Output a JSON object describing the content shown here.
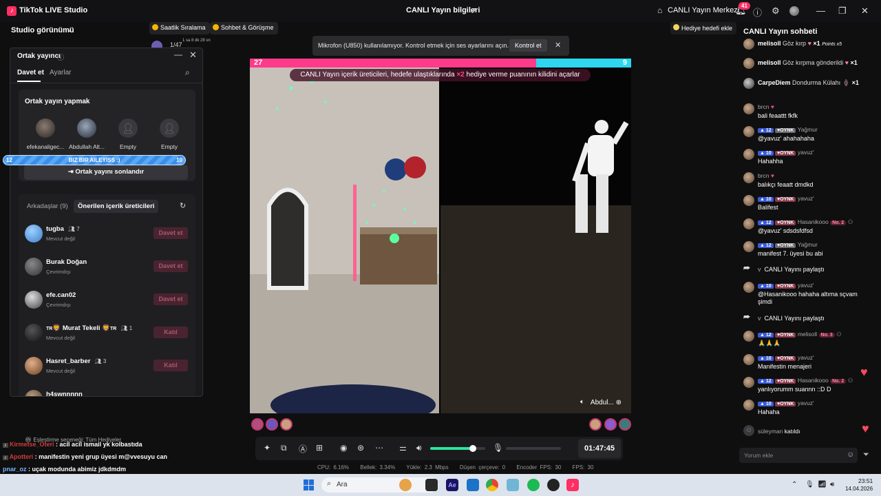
{
  "titlebar": {
    "app_name": "TikTok LIVE Studio",
    "live_info": "CANLI Yayın bilgileri",
    "live_center": "CANLI Yayın Merkezi",
    "notification_count": "41"
  },
  "studio": {
    "view_label": "Studio görünümü",
    "chips": [
      "Saatlik Sıralama",
      "Sohbet & Görüşme"
    ],
    "viewer_counter": "1/47",
    "viewer_time": "1 sa 8 dk 28 sn"
  },
  "cohost": {
    "title": "Ortak yayıncı",
    "tabs": [
      "Davet et",
      "Ayarlar"
    ],
    "cohosting_title": "Ortak yayın yapmak",
    "slots": [
      "efekanaligec...",
      "Abdullah Alt...",
      "Empty",
      "Empty"
    ],
    "team_bar": {
      "left": "12",
      "label": "BIZ BIR AILEYISS :)",
      "right": "10"
    },
    "end_button": "Ortak yayını sonlandır",
    "friends_tab": "Arkadaşlar (9)",
    "suggested_tab": "Önerilen içerik üreticileri",
    "creators": [
      {
        "name": "tugba",
        "count": "7",
        "status": "Mevcut değil",
        "action": "Davet et"
      },
      {
        "name": "Burak Doğan",
        "count": "",
        "status": "Çevrimdışı",
        "action": "Davet et"
      },
      {
        "name": "efe.can02",
        "count": "",
        "status": "Çevrimdışı",
        "action": "Davet et"
      },
      {
        "name": "Murat Tekeli",
        "prefix": "TR",
        "suffix": "TR",
        "count": "1",
        "status": "Mevcut değil",
        "action": "Katıl"
      },
      {
        "name": "Hasret_barber",
        "count": "3",
        "status": "Mevcut değil",
        "action": "Katıl"
      },
      {
        "name": "h4swnnnnn",
        "count": "",
        "status": "",
        "action": ""
      }
    ]
  },
  "notification": {
    "text": "Mikrofon (U850) kullanılamıyor. Kontrol etmek için ses ayarlarını açın.",
    "button": "Kontrol et"
  },
  "gift_goal": "Hediye hedefi ekle",
  "video": {
    "score_left": "27",
    "score_right": "9",
    "score_left_fraction": 0.75,
    "banner_pre": "CANLI Yayın içerik üreticileri, hedefe ulaştıklarında ",
    "banner_mult": "×2",
    "banner_post": " hediye verme puanının kilidini açarlar",
    "guest_name": "Abdul..."
  },
  "controls": {
    "volume_level": 0.78,
    "timer": "01:47:45"
  },
  "stats": [
    "CPU: 6.16%",
    "Bellek: 3.34%",
    "Yükle: 2.3 Mbps",
    "Düşen çerçeve: 0",
    "Encoder FPS: 30",
    "FPS: 30"
  ],
  "overlay_chat": [
    {
      "name": "Kirmetse_Oteri",
      "msg": " : acil acil ismail yk kolbastıda"
    },
    {
      "name": "Apotteri",
      "msg": " : manifestin yeni grup üyesi m@vvesuyu can"
    },
    {
      "name": "pnar_oz",
      "msg": " : uçak modunda abimiz jdkdmdm"
    }
  ],
  "match_pref": "Eşleştirme seçeneği: Tüm Hediyeler",
  "chat": {
    "title": "CANLI Yayın sohbeti",
    "gifts": [
      {
        "user": "melisoll",
        "text": "Göz kırp",
        "mult": "×1",
        "points": "Points x5"
      },
      {
        "user": "melisoll",
        "text": "Göz kırpma gönderildi",
        "mult": "×1"
      },
      {
        "user": "CarpeDiem",
        "text": "Dondurma Külahı",
        "mult": "×1"
      }
    ],
    "messages": [
      {
        "user": "brcn",
        "lvl": "",
        "fan": "",
        "msg": "bali feaattt fkfk"
      },
      {
        "user": "Yağmur",
        "lvl": "12",
        "fan": "OYNK",
        "msg": "@yavuz' ahahahaha"
      },
      {
        "user": "yavuz'",
        "lvl": "10",
        "fan": "OYNK",
        "msg": "Hahahha"
      },
      {
        "user": "brcn",
        "lvl": "",
        "fan": "",
        "msg": "balıkçı feaatt dmdkd"
      },
      {
        "user": "yavuz'",
        "lvl": "10",
        "fan": "OYNK",
        "msg": "Balifest"
      },
      {
        "user": "Hasanikooo",
        "lvl": "12",
        "fan": "OYNK",
        "rank": "No. 2",
        "msg": "@yavuz' sdsdsfdfsd"
      },
      {
        "user": "Yağmur",
        "lvl": "12",
        "fan": "OYNK",
        "msg": "manifest 7. üyesi bu abi"
      },
      {
        "user": "v",
        "lvl": "",
        "fan": "",
        "msg": "CANLI Yayını paylaştı",
        "share": true
      },
      {
        "user": "yavuz'",
        "lvl": "10",
        "fan": "OYNK",
        "msg": "@Hasanikooo hahaha altıma sçvam şimdi"
      },
      {
        "user": "v",
        "lvl": "",
        "fan": "",
        "msg": "CANLI Yayını paylaştı",
        "share": true
      },
      {
        "user": "melisoll",
        "lvl": "12",
        "fan": "OYNK",
        "rank": "No. 3",
        "msg": "🙏🙏🙏"
      },
      {
        "user": "yavuz'",
        "lvl": "10",
        "fan": "OYNK",
        "msg": "Manifestin menajeri"
      },
      {
        "user": "Hasanikooo",
        "lvl": "12",
        "fan": "OYNK",
        "rank": "No. 2",
        "msg": "yanlıyorumm suannn ::D D"
      },
      {
        "user": "yavuz'",
        "lvl": "10",
        "fan": "OYNK",
        "msg": "Hahaha"
      }
    ],
    "joined": {
      "user": "süleyman",
      "text": "katıldı"
    },
    "comment_placeholder": "Yorum ekle"
  },
  "taskbar": {
    "search": "Ara",
    "time": "23:51",
    "date": "14.04.2026"
  }
}
